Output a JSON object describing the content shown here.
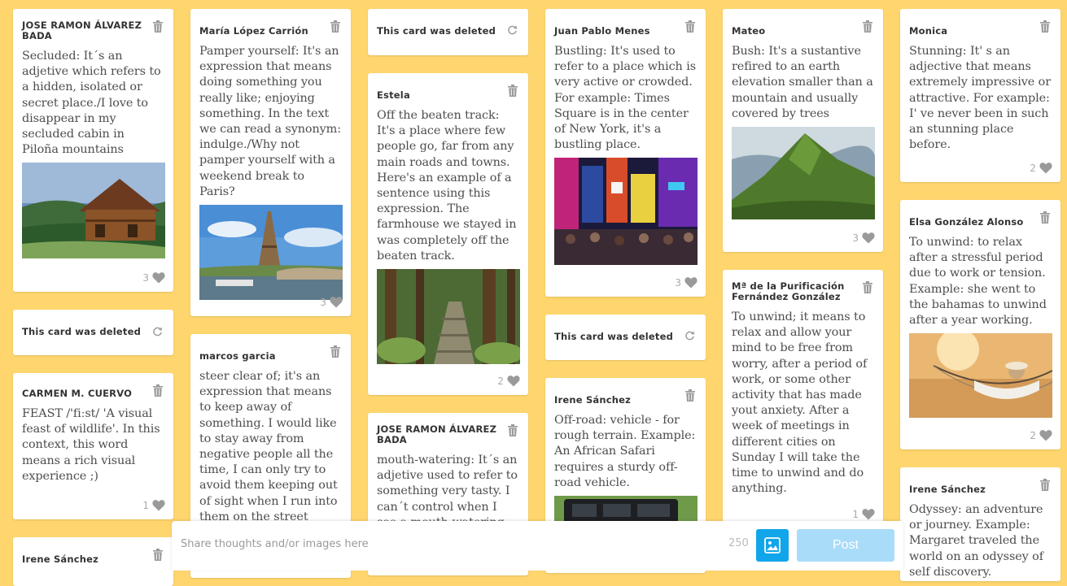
{
  "colors": {
    "background": "#ffd66e",
    "accent": "#11a5ea",
    "post_disabled": "#a9dcf9"
  },
  "icons": {
    "delete": "trash-icon",
    "restore": "refresh-icon",
    "like": "heart-icon",
    "image": "image-icon"
  },
  "cards": {
    "c1": {
      "author": "JOSE RAMON ÁLVAREZ BADA",
      "text": "Secluded: It´s an adjetive which refers to a hidden, isolated or secret place./I love to disappear in my secluded cabin in Piloña mountains",
      "likes": "3"
    },
    "c2": {
      "author": "This card was deleted"
    },
    "c3": {
      "author": "CARMEN M. CUERVO",
      "text": "FEAST /'fiːst/ 'A visual feast of wildlife'. In this context, this word means a rich visual experience ;)",
      "likes": "1"
    },
    "c4": {
      "author": "Irene Sánchez"
    },
    "c5": {
      "author": "María López Carrión",
      "text": "Pamper yourself: It's an expression that means doing something you really like; enjoying something. In the text we can read a synonym: indulge./Why not pamper yourself with a weekend break to Paris?",
      "likes": "3"
    },
    "c6": {
      "author": "marcos garcia",
      "text": "steer clear of; it's an expression that means to keep away of something. I would like to stay away from negative people all the time, I can only try to avoid them keeping out of sight when I run into them on the street"
    },
    "c7": {
      "author": "This card was deleted"
    },
    "c8": {
      "author": "Estela",
      "text": "Off the beaten track: It's a place where few people go, far from any main roads and towns. Here's an example of a sentence using this expression. The farmhouse we stayed in was completely off the beaten track.",
      "likes": "2"
    },
    "c9": {
      "author": "JOSE RAMON ÁLVAREZ BADA",
      "text": "mouth-watering: It´s an adjetive used to refer to something very tasty. I can´t control when I see a mouth-watering pie"
    },
    "c10": {
      "author": "Juan Pablo Menes",
      "text": "Bustling: It's used to refer to a place which is very active or crowded. For example: Times Square is in the center of New York, it's a bustling place.",
      "likes": "3"
    },
    "c11": {
      "author": "This card was deleted"
    },
    "c12": {
      "author": "Irene Sánchez",
      "text": "Off-road: vehicle - for rough terrain. Example: An African Safari requires a sturdy off-road vehicle."
    },
    "c13": {
      "author": "Mateo",
      "text": "Bush: It's a sustantive refired to an earth elevation smaller than a mountain and usually covered by trees",
      "likes": "3"
    },
    "c14": {
      "author": "Mª de la Purificación Fernández González",
      "text": "To unwind; it means to relax and allow your mind to be free from worry, after a period of work, or some other activity that has made yout anxiety. After a week of meetings in different cities on Sunday I will take the time to unwind and do anything.",
      "likes": "1"
    },
    "c15": {
      "author": "Monica",
      "text": "Stunning: It' s an adjective that means extremely impressive or attractive. For example: I' ve never been in such an stunning place before.",
      "likes": "2"
    },
    "c16": {
      "author": "Elsa González Alonso",
      "text": "To unwind: to relax after a stressful period due to work or tension. Example: she went to the bahamas to unwind after a year working.",
      "likes": "2"
    },
    "c17": {
      "author": "Irene Sánchez",
      "text": "Odyssey: an adventure or journey. Example: Margaret traveled the world on an odyssey of self discovery."
    }
  },
  "composer": {
    "placeholder": "Share thoughts and/or images here",
    "counter": "250",
    "post_label": "Post"
  }
}
